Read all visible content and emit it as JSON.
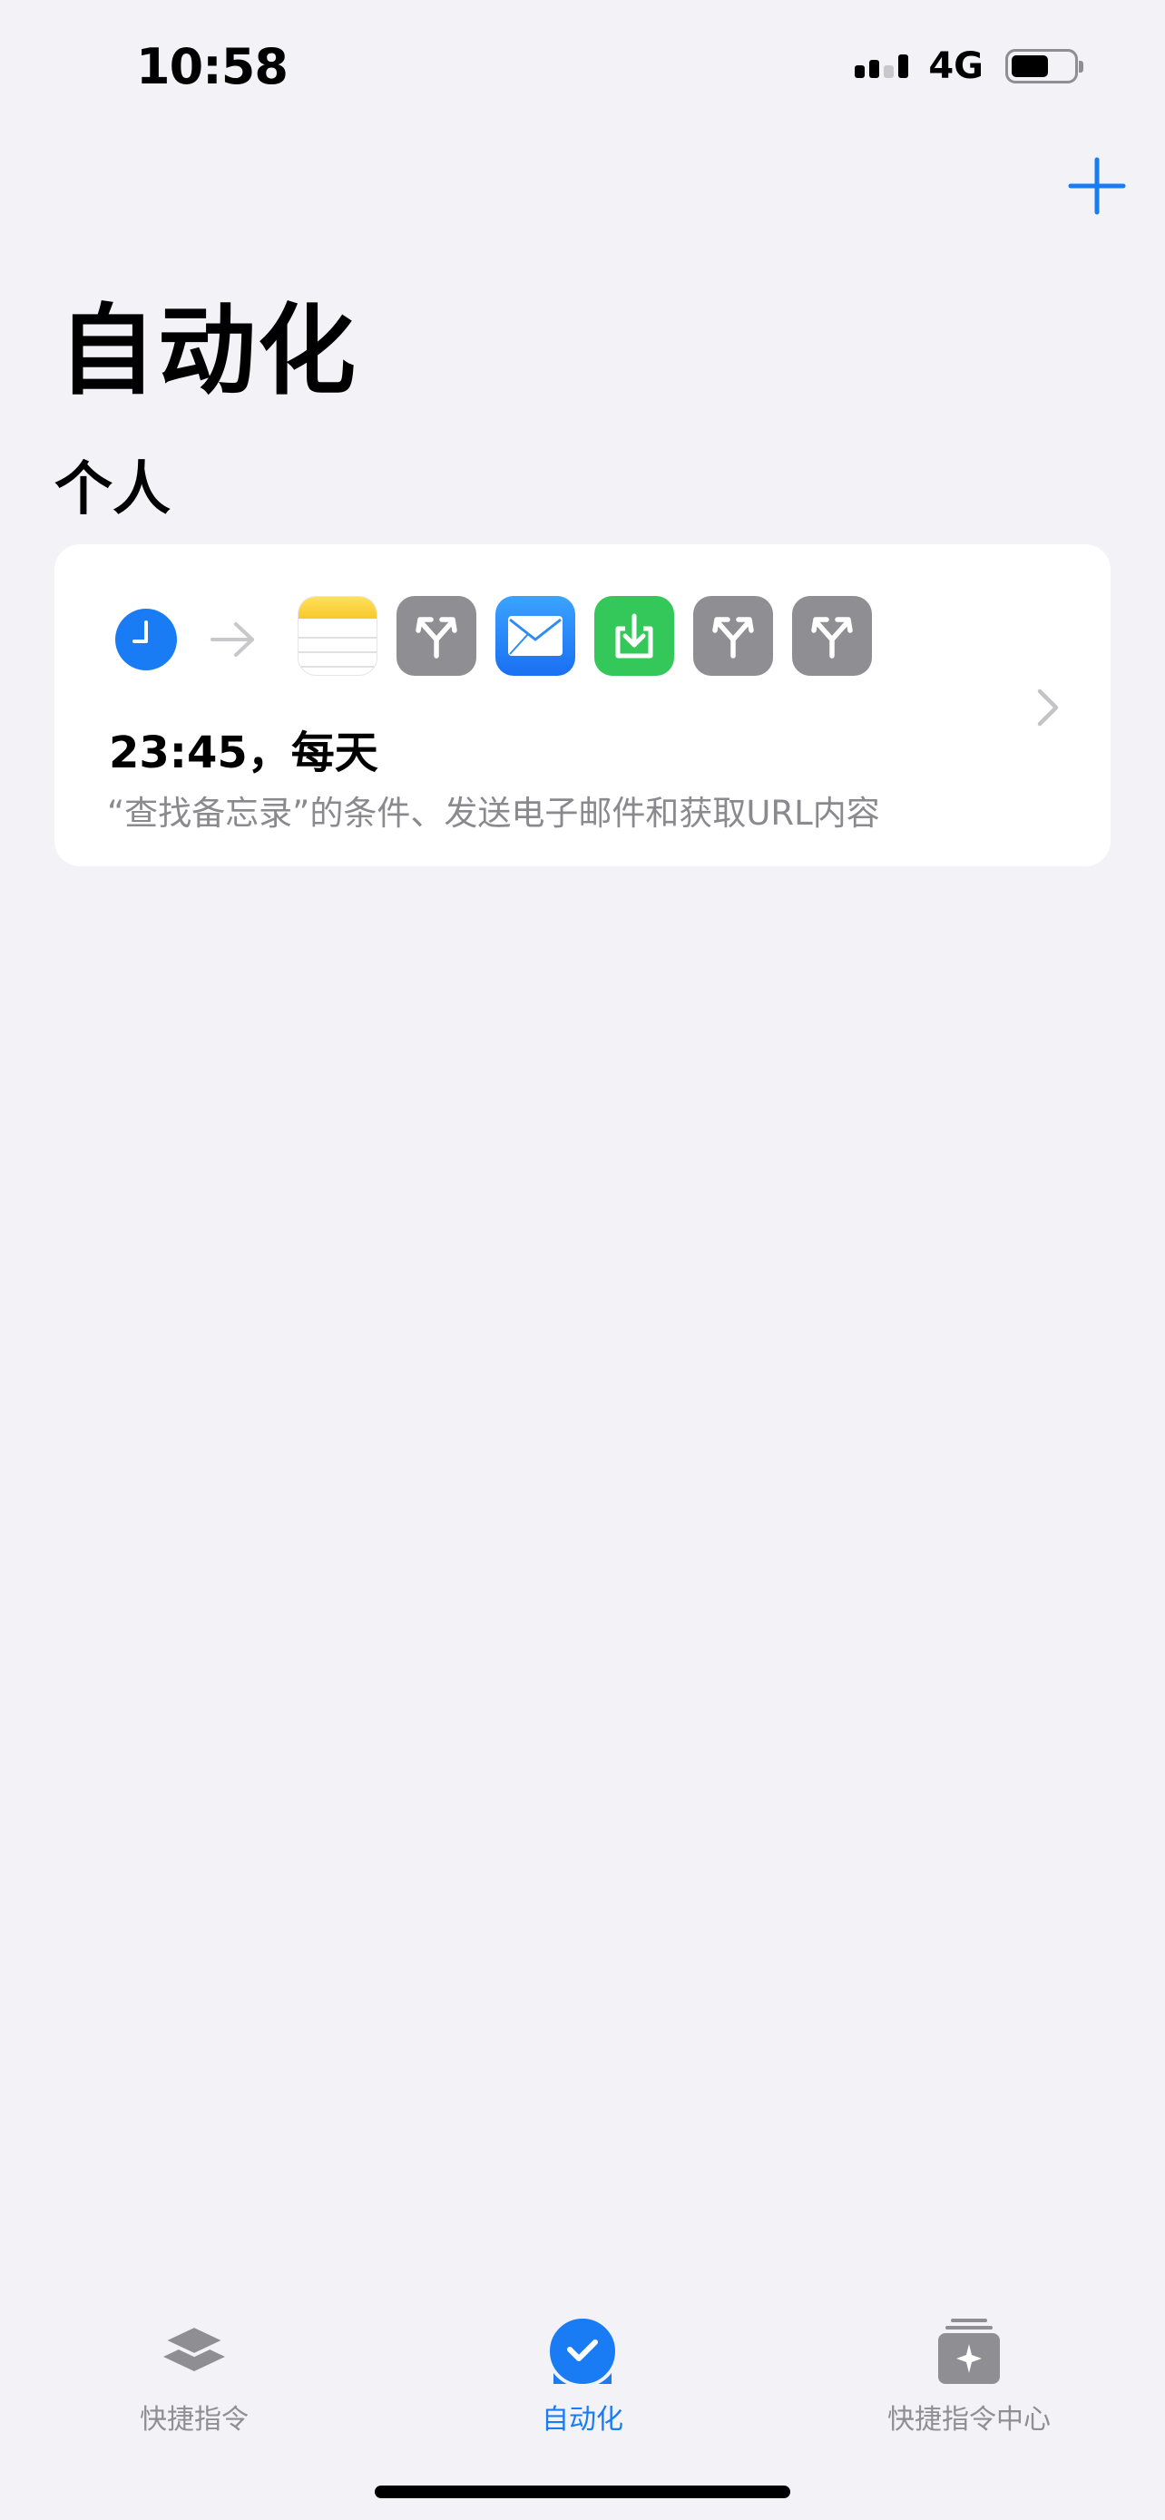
{
  "status_bar": {
    "time": "10:58",
    "network": "4G",
    "battery_level": 0.6
  },
  "header": {
    "title": "自动化",
    "add_icon": "plus-icon"
  },
  "section": {
    "title": "个人"
  },
  "automation": {
    "trigger_icon": "clock-icon",
    "action_icons": [
      "notes-icon",
      "branch-icon",
      "mail-icon",
      "download-icon",
      "branch-icon",
      "branch-icon"
    ],
    "title": "23:45，每天",
    "subtitle": "“查找备忘录”的条件、发送电子邮件和获取URL内容"
  },
  "tab_bar": {
    "tabs": [
      {
        "label": "快捷指令",
        "icon": "layers-icon",
        "active": false
      },
      {
        "label": "自动化",
        "icon": "check-circle-icon",
        "active": true
      },
      {
        "label": "快捷指令中心",
        "icon": "gallery-icon",
        "active": false
      }
    ]
  },
  "colors": {
    "accent": "#1a7cf5",
    "background": "#f2f2f7",
    "card": "#ffffff",
    "secondary_text": "#8a8a8e"
  }
}
